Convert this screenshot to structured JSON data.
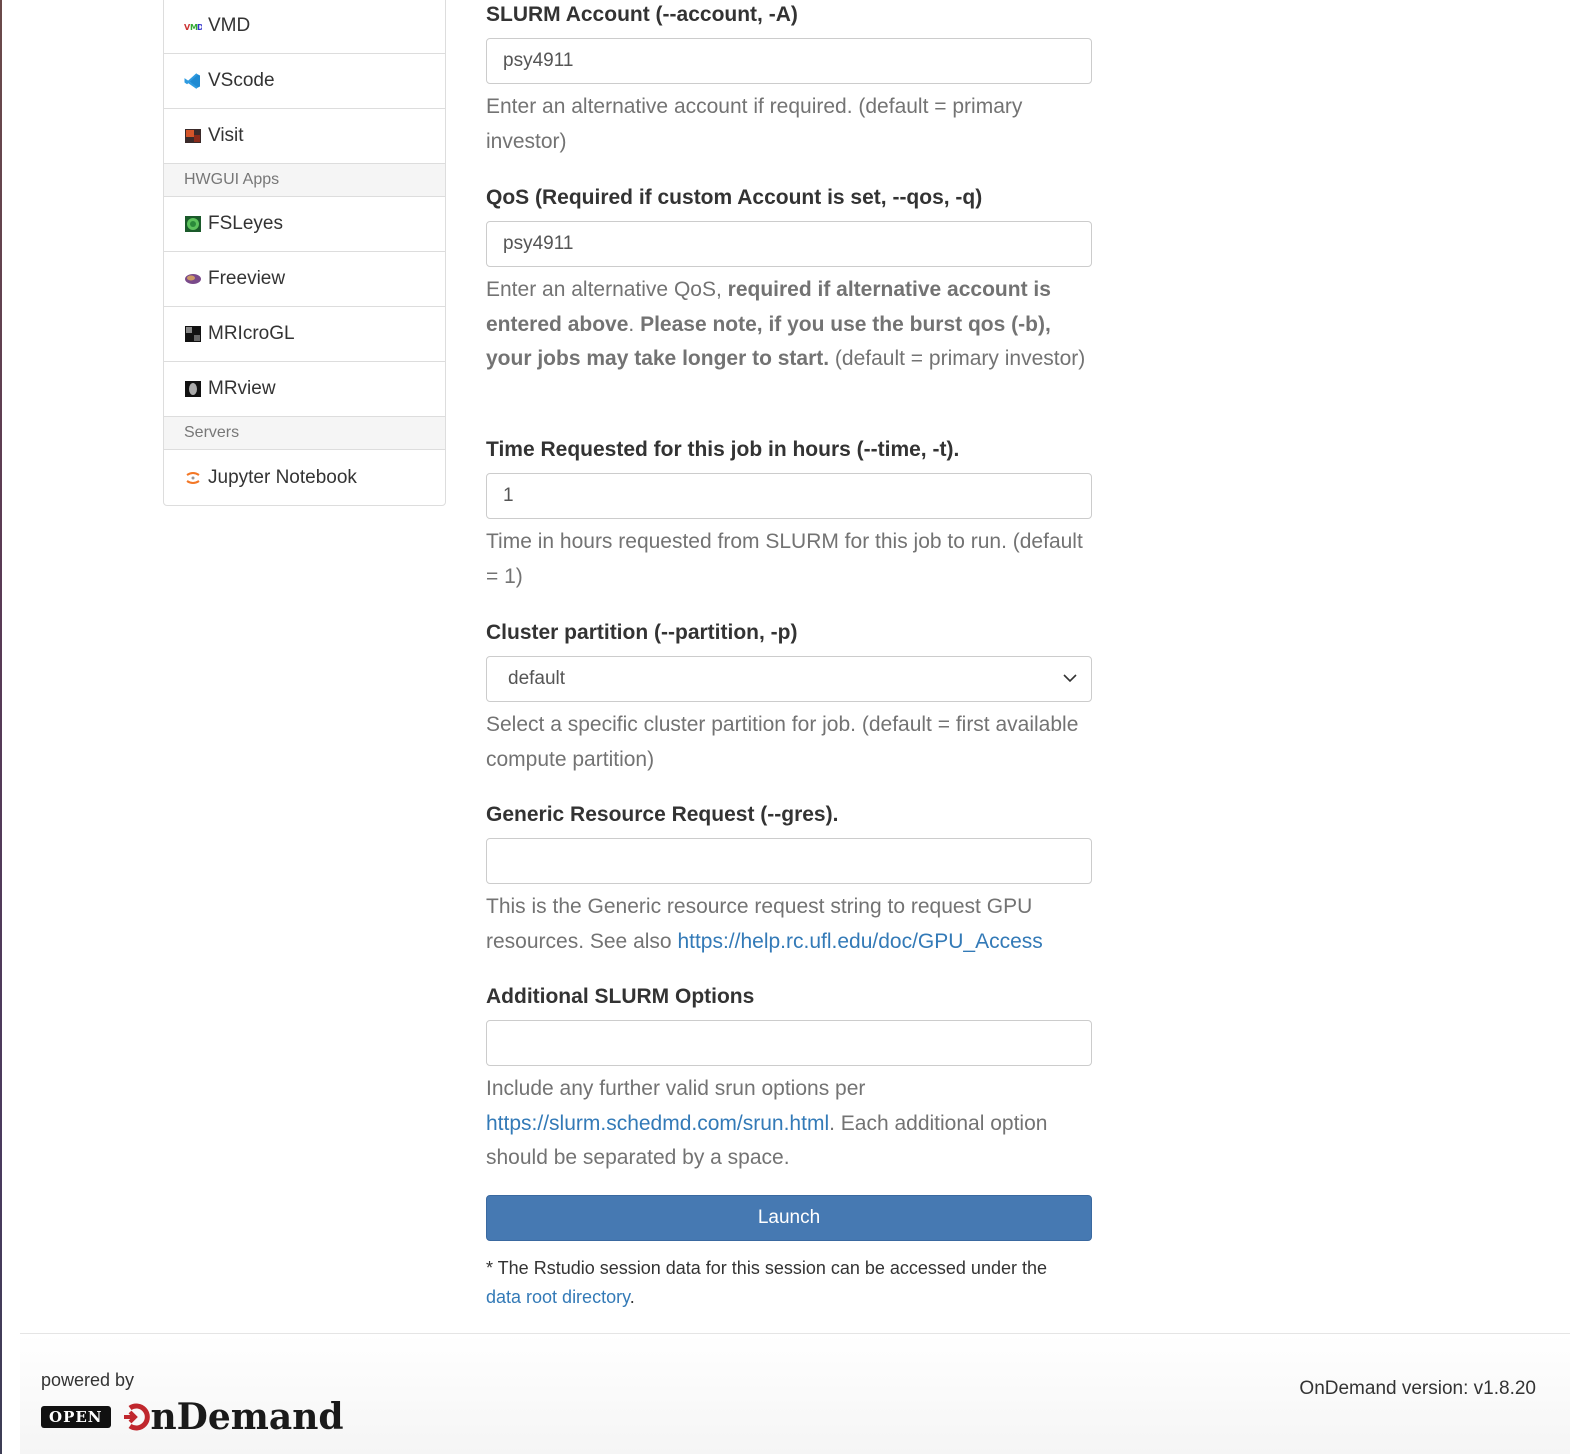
{
  "sidebar": {
    "items_top": [
      {
        "label": "VMD",
        "icon": "vmd-icon"
      },
      {
        "label": "VScode",
        "icon": "vscode-icon"
      },
      {
        "label": "Visit",
        "icon": "visit-icon"
      }
    ],
    "header_hwgui": "HWGUI Apps",
    "items_hwgui": [
      {
        "label": "FSLeyes",
        "icon": "fsleyes-icon"
      },
      {
        "label": "Freeview",
        "icon": "freeview-icon"
      },
      {
        "label": "MRIcroGL",
        "icon": "mricrogl-icon"
      },
      {
        "label": "MRview",
        "icon": "mrview-icon"
      }
    ],
    "header_servers": "Servers",
    "items_servers": [
      {
        "label": "Jupyter Notebook",
        "icon": "jupyter-icon"
      }
    ]
  },
  "form": {
    "account": {
      "label": "SLURM Account (--account, -A)",
      "value": "psy4911",
      "help": "Enter an alternative account if required. (default = primary investor)"
    },
    "qos": {
      "label": "QoS (Required if custom Account is set, --qos, -q)",
      "value": "psy4911",
      "help_pre": "Enter an alternative QoS, ",
      "help_bold": "required if alternative account is entered above",
      "help_mid": ". ",
      "help_bold2": "Please note, if you use the burst qos (-b), your jobs may take longer to start.",
      "help_post": " (default = primary investor)"
    },
    "time": {
      "label": "Time Requested for this job in hours (--time, -t).",
      "value": "1",
      "help": "Time in hours requested from SLURM for this job to run. (default = 1)"
    },
    "partition": {
      "label": "Cluster partition (--partition, -p)",
      "value": "default",
      "help": "Select a specific cluster partition for job. (default = first available compute partition)"
    },
    "gres": {
      "label": "Generic Resource Request (--gres).",
      "value": "",
      "help_pre": "This is the Generic resource request string to request GPU resources. See also ",
      "help_link": "https://help.rc.ufl.edu/doc/GPU_Access"
    },
    "additional": {
      "label": "Additional SLURM Options",
      "value": "",
      "help_pre": "Include any further valid srun options per ",
      "help_link": "https://slurm.schedmd.com/srun.html",
      "help_post": ". Each additional option should be separated by a space."
    },
    "launch_label": "Launch",
    "note_pre": "* The Rstudio session data for this session can be accessed under the ",
    "note_link": "data root directory",
    "note_post": "."
  },
  "footer": {
    "powered_by": "powered by",
    "badge": "OPEN",
    "brand": "nDemand",
    "version": "OnDemand version: v1.8.20"
  },
  "colors": {
    "primary": "#4679b2",
    "link": "#337ab7",
    "brand_red": "#c0272d"
  }
}
